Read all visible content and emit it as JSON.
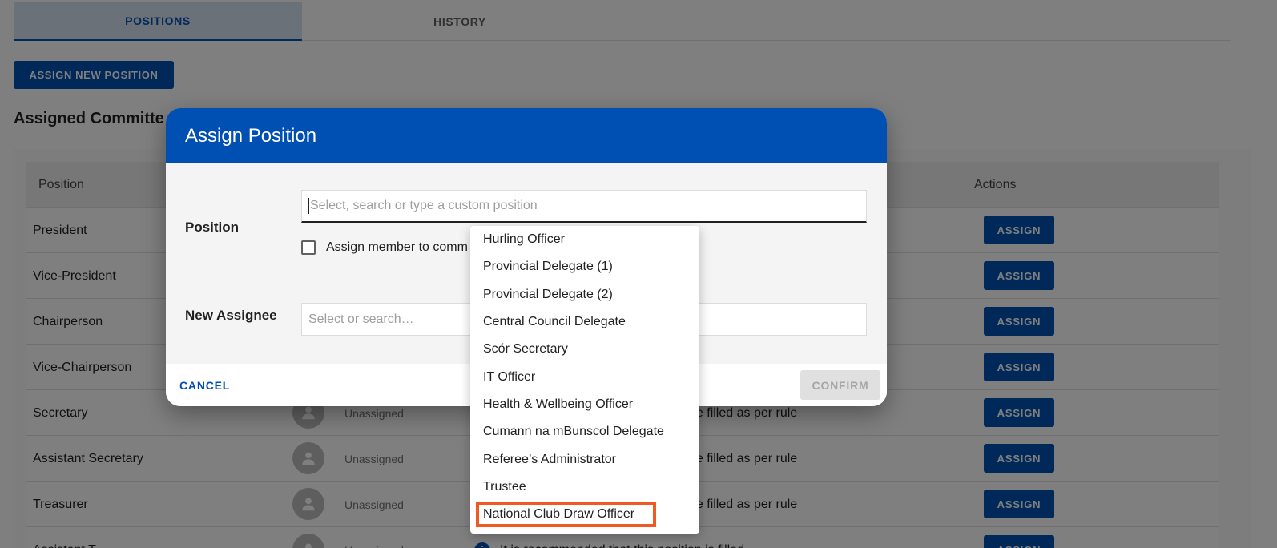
{
  "tabs": [
    {
      "label": "POSITIONS",
      "active": true
    },
    {
      "label": "HISTORY",
      "active": false
    }
  ],
  "assign_new_button": "ASSIGN NEW POSITION",
  "section_title": "Assigned Committe",
  "table": {
    "headers": {
      "position": "Position",
      "actions": "Actions"
    },
    "rows": [
      {
        "position": "President",
        "assignee": "",
        "note": "",
        "action": "ASSIGN"
      },
      {
        "position": "Vice-President",
        "assignee": "",
        "note": "",
        "action": "ASSIGN"
      },
      {
        "position": "Chairperson",
        "assignee": "",
        "note": "",
        "action": "ASSIGN"
      },
      {
        "position": "Vice-Chairperson",
        "assignee": "",
        "note": "",
        "action": "ASSIGN"
      },
      {
        "position": "Secretary",
        "assignee": "Unassigned",
        "note": "be filled as per rule",
        "action": "ASSIGN"
      },
      {
        "position": "Assistant Secretary",
        "assignee": "Unassigned",
        "note": "be filled as per rule",
        "action": "ASSIGN"
      },
      {
        "position": "Treasurer",
        "assignee": "Unassigned",
        "note": "be filled as per rule",
        "action": "ASSIGN"
      },
      {
        "position": "Assistant T",
        "assignee": "Unassigned",
        "note": "It is recommended that this position is filled",
        "action": "ASSIGN"
      }
    ]
  },
  "dialog": {
    "title": "Assign Position",
    "position_label": "Position",
    "position_placeholder": "Select, search or type a custom position",
    "checkbox_label": "Assign member to comm",
    "checkbox_checked": false,
    "assignee_label": "New Assignee",
    "assignee_placeholder": "Select or search…",
    "cancel_label": "CANCEL",
    "confirm_label": "CONFIRM"
  },
  "dropdown": {
    "options": [
      "Hurling Officer",
      "Provincial Delegate (1)",
      "Provincial Delegate (2)",
      "Central Council Delegate",
      "Scór Secretary",
      "IT Officer",
      "Health & Wellbeing Officer",
      "Cumann na mBunscol Delegate",
      "Referee’s Administrator",
      "Trustee",
      "National Club Draw Officer"
    ],
    "highlighted": "National Club Draw Officer"
  },
  "colors": {
    "brand": "#0050b3",
    "highlight": "#f05a22"
  },
  "icons": {
    "avatar": "person-icon",
    "note": "info-icon"
  }
}
